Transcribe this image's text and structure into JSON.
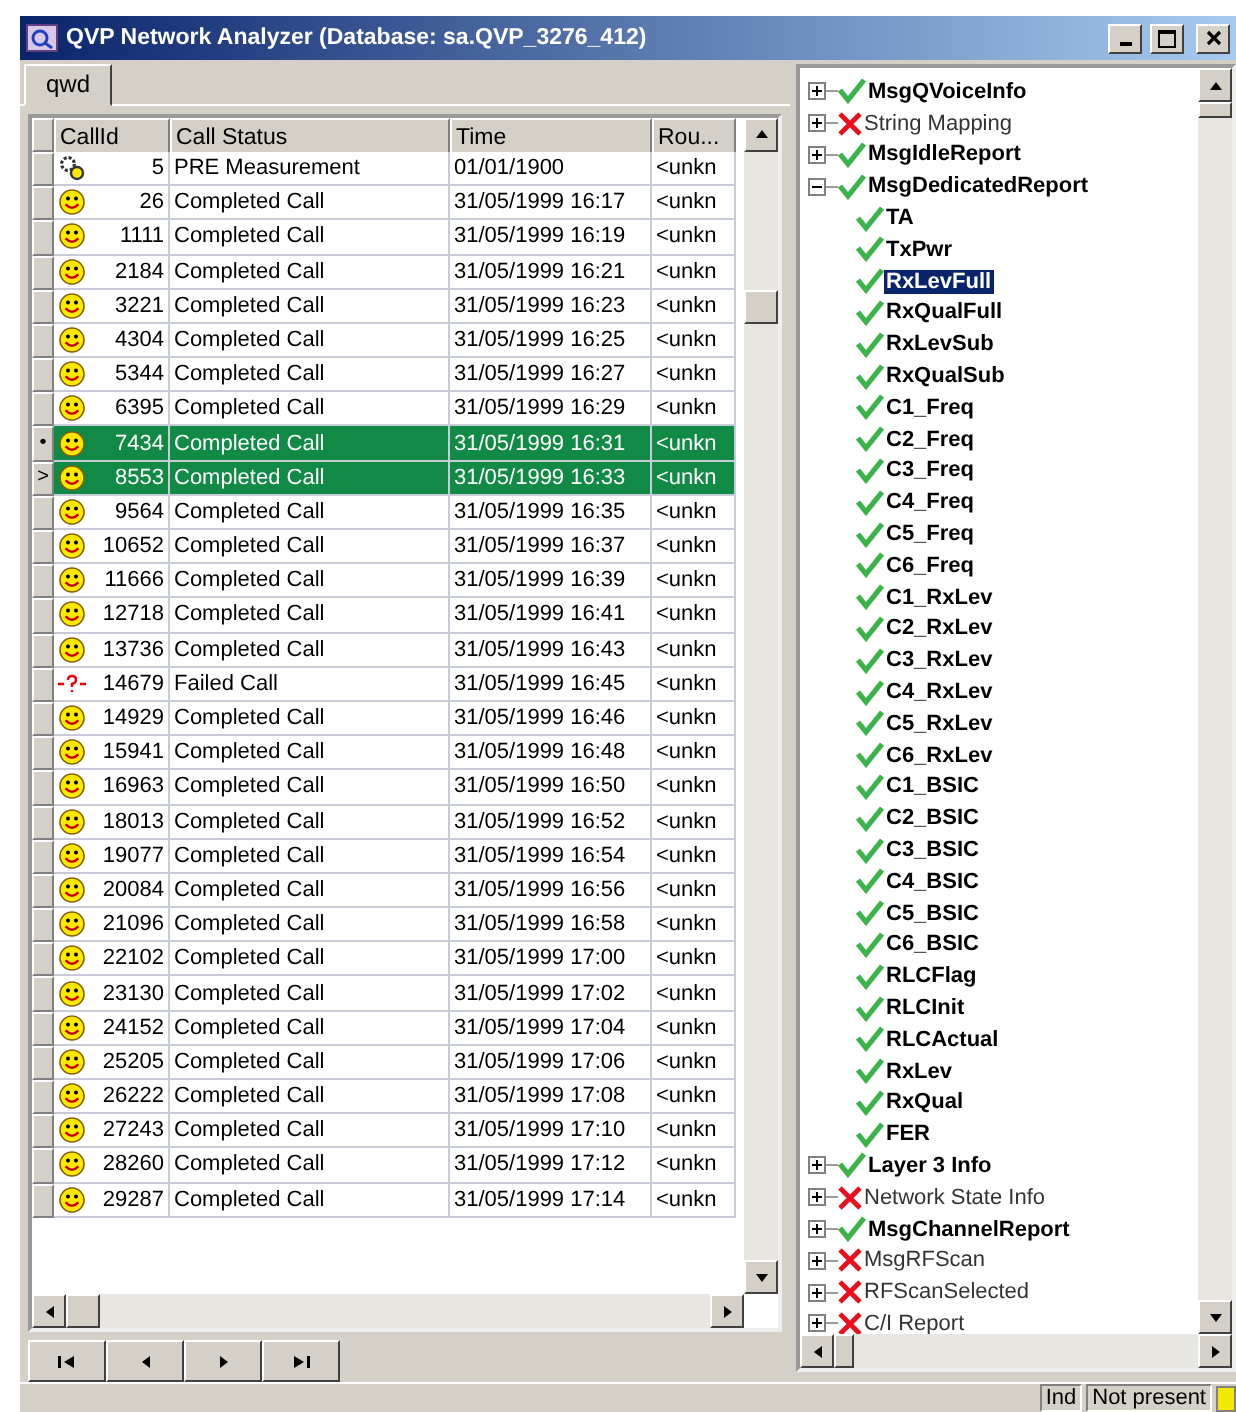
{
  "window": {
    "title": "QVP Network Analyzer (Database: sa.QVP_3276_412)"
  },
  "tabs": [
    {
      "label": "qwd",
      "selected": true
    }
  ],
  "table": {
    "columns": [
      "CallId",
      "Call Status",
      "Time",
      "Rou..."
    ],
    "rows": [
      {
        "kind": "pre",
        "call_id": "5",
        "status": "PRE Measurement",
        "time": "01/01/1900",
        "route": "<unkn",
        "selected": false
      },
      {
        "kind": "completed",
        "call_id": "26",
        "status": "Completed Call",
        "time": "31/05/1999 16:17",
        "route": "<unkn",
        "selected": false
      },
      {
        "kind": "completed",
        "call_id": "1111",
        "status": "Completed Call",
        "time": "31/05/1999 16:19",
        "route": "<unkn",
        "selected": false
      },
      {
        "kind": "completed",
        "call_id": "2184",
        "status": "Completed Call",
        "time": "31/05/1999 16:21",
        "route": "<unkn",
        "selected": false
      },
      {
        "kind": "completed",
        "call_id": "3221",
        "status": "Completed Call",
        "time": "31/05/1999 16:23",
        "route": "<unkn",
        "selected": false
      },
      {
        "kind": "completed",
        "call_id": "4304",
        "status": "Completed Call",
        "time": "31/05/1999 16:25",
        "route": "<unkn",
        "selected": false
      },
      {
        "kind": "completed",
        "call_id": "5344",
        "status": "Completed Call",
        "time": "31/05/1999 16:27",
        "route": "<unkn",
        "selected": false
      },
      {
        "kind": "completed",
        "call_id": "6395",
        "status": "Completed Call",
        "time": "31/05/1999 16:29",
        "route": "<unkn",
        "selected": false
      },
      {
        "kind": "completed",
        "call_id": "7434",
        "status": "Completed Call",
        "time": "31/05/1999 16:31",
        "route": "<unkn",
        "selected": true,
        "indicator": "•"
      },
      {
        "kind": "completed",
        "call_id": "8553",
        "status": "Completed Call",
        "time": "31/05/1999 16:33",
        "route": "<unkn",
        "selected": true,
        "indicator": ">"
      },
      {
        "kind": "completed",
        "call_id": "9564",
        "status": "Completed Call",
        "time": "31/05/1999 16:35",
        "route": "<unkn",
        "selected": false
      },
      {
        "kind": "completed",
        "call_id": "10652",
        "status": "Completed Call",
        "time": "31/05/1999 16:37",
        "route": "<unkn",
        "selected": false
      },
      {
        "kind": "completed",
        "call_id": "11666",
        "status": "Completed Call",
        "time": "31/05/1999 16:39",
        "route": "<unkn",
        "selected": false
      },
      {
        "kind": "completed",
        "call_id": "12718",
        "status": "Completed Call",
        "time": "31/05/1999 16:41",
        "route": "<unkn",
        "selected": false
      },
      {
        "kind": "completed",
        "call_id": "13736",
        "status": "Completed Call",
        "time": "31/05/1999 16:43",
        "route": "<unkn",
        "selected": false
      },
      {
        "kind": "failed",
        "call_id": "14679",
        "status": "Failed Call",
        "time": "31/05/1999 16:45",
        "route": "<unkn",
        "selected": false
      },
      {
        "kind": "completed",
        "call_id": "14929",
        "status": "Completed Call",
        "time": "31/05/1999 16:46",
        "route": "<unkn",
        "selected": false
      },
      {
        "kind": "completed",
        "call_id": "15941",
        "status": "Completed Call",
        "time": "31/05/1999 16:48",
        "route": "<unkn",
        "selected": false
      },
      {
        "kind": "completed",
        "call_id": "16963",
        "status": "Completed Call",
        "time": "31/05/1999 16:50",
        "route": "<unkn",
        "selected": false
      },
      {
        "kind": "completed",
        "call_id": "18013",
        "status": "Completed Call",
        "time": "31/05/1999 16:52",
        "route": "<unkn",
        "selected": false
      },
      {
        "kind": "completed",
        "call_id": "19077",
        "status": "Completed Call",
        "time": "31/05/1999 16:54",
        "route": "<unkn",
        "selected": false
      },
      {
        "kind": "completed",
        "call_id": "20084",
        "status": "Completed Call",
        "time": "31/05/1999 16:56",
        "route": "<unkn",
        "selected": false
      },
      {
        "kind": "completed",
        "call_id": "21096",
        "status": "Completed Call",
        "time": "31/05/1999 16:58",
        "route": "<unkn",
        "selected": false
      },
      {
        "kind": "completed",
        "call_id": "22102",
        "status": "Completed Call",
        "time": "31/05/1999 17:00",
        "route": "<unkn",
        "selected": false
      },
      {
        "kind": "completed",
        "call_id": "23130",
        "status": "Completed Call",
        "time": "31/05/1999 17:02",
        "route": "<unkn",
        "selected": false
      },
      {
        "kind": "completed",
        "call_id": "24152",
        "status": "Completed Call",
        "time": "31/05/1999 17:04",
        "route": "<unkn",
        "selected": false
      },
      {
        "kind": "completed",
        "call_id": "25205",
        "status": "Completed Call",
        "time": "31/05/1999 17:06",
        "route": "<unkn",
        "selected": false
      },
      {
        "kind": "completed",
        "call_id": "26222",
        "status": "Completed Call",
        "time": "31/05/1999 17:08",
        "route": "<unkn",
        "selected": false
      },
      {
        "kind": "completed",
        "call_id": "27243",
        "status": "Completed Call",
        "time": "31/05/1999 17:10",
        "route": "<unkn",
        "selected": false
      },
      {
        "kind": "completed",
        "call_id": "28260",
        "status": "Completed Call",
        "time": "31/05/1999 17:12",
        "route": "<unkn",
        "selected": false
      },
      {
        "kind": "completed",
        "call_id": "29287",
        "status": "Completed Call",
        "time": "31/05/1999 17:14",
        "route": "<unkn",
        "selected": false
      }
    ]
  },
  "tree": [
    {
      "label": "MsgQVoiceInfo",
      "kind": "ok",
      "expanded": false
    },
    {
      "label": "String Mapping",
      "kind": "error",
      "expanded": false
    },
    {
      "label": "MsgIdleReport",
      "kind": "ok",
      "expanded": false
    },
    {
      "label": "MsgDedicatedReport",
      "kind": "ok",
      "expanded": true,
      "children": [
        {
          "label": "TA",
          "kind": "ok",
          "selected": false
        },
        {
          "label": "TxPwr",
          "kind": "ok",
          "selected": false
        },
        {
          "label": "RxLevFull",
          "kind": "ok",
          "selected": true
        },
        {
          "label": "RxQualFull",
          "kind": "ok",
          "selected": false
        },
        {
          "label": "RxLevSub",
          "kind": "ok",
          "selected": false
        },
        {
          "label": "RxQualSub",
          "kind": "ok",
          "selected": false
        },
        {
          "label": "C1_Freq",
          "kind": "ok",
          "selected": false
        },
        {
          "label": "C2_Freq",
          "kind": "ok",
          "selected": false
        },
        {
          "label": "C3_Freq",
          "kind": "ok",
          "selected": false
        },
        {
          "label": "C4_Freq",
          "kind": "ok",
          "selected": false
        },
        {
          "label": "C5_Freq",
          "kind": "ok",
          "selected": false
        },
        {
          "label": "C6_Freq",
          "kind": "ok",
          "selected": false
        },
        {
          "label": "C1_RxLev",
          "kind": "ok",
          "selected": false
        },
        {
          "label": "C2_RxLev",
          "kind": "ok",
          "selected": false
        },
        {
          "label": "C3_RxLev",
          "kind": "ok",
          "selected": false
        },
        {
          "label": "C4_RxLev",
          "kind": "ok",
          "selected": false
        },
        {
          "label": "C5_RxLev",
          "kind": "ok",
          "selected": false
        },
        {
          "label": "C6_RxLev",
          "kind": "ok",
          "selected": false
        },
        {
          "label": "C1_BSIC",
          "kind": "ok",
          "selected": false
        },
        {
          "label": "C2_BSIC",
          "kind": "ok",
          "selected": false
        },
        {
          "label": "C3_BSIC",
          "kind": "ok",
          "selected": false
        },
        {
          "label": "C4_BSIC",
          "kind": "ok",
          "selected": false
        },
        {
          "label": "C5_BSIC",
          "kind": "ok",
          "selected": false
        },
        {
          "label": "C6_BSIC",
          "kind": "ok",
          "selected": false
        },
        {
          "label": "RLCFlag",
          "kind": "ok",
          "selected": false
        },
        {
          "label": "RLCInit",
          "kind": "ok",
          "selected": false
        },
        {
          "label": "RLCActual",
          "kind": "ok",
          "selected": false
        },
        {
          "label": "RxLev",
          "kind": "ok",
          "selected": false
        },
        {
          "label": "RxQual",
          "kind": "ok",
          "selected": false
        },
        {
          "label": "FER",
          "kind": "ok",
          "selected": false
        }
      ]
    },
    {
      "label": "Layer 3 Info",
      "kind": "ok",
      "expanded": false
    },
    {
      "label": "Network State Info",
      "kind": "error",
      "expanded": false
    },
    {
      "label": "MsgChannelReport",
      "kind": "ok",
      "expanded": false
    },
    {
      "label": "MsgRFScan",
      "kind": "error",
      "expanded": false
    },
    {
      "label": "RFScanSelected",
      "kind": "error",
      "expanded": false
    },
    {
      "label": "C/I Report",
      "kind": "error",
      "expanded": false
    }
  ],
  "status_bar": {
    "fields": [
      "Ind",
      "Not present"
    ]
  }
}
